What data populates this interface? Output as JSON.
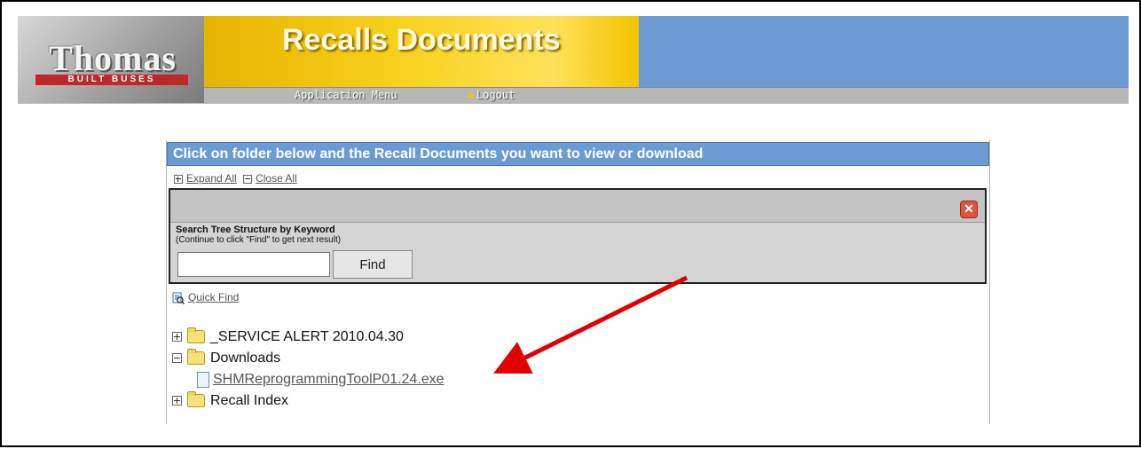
{
  "header": {
    "logo_text": "Thomas",
    "logo_subtext": "BUILT BUSES",
    "title": "Recalls Documents",
    "menu": {
      "application_menu": "Application Menu",
      "logout": "Logout"
    }
  },
  "panel": {
    "title": "Click on folder below and the Recall Documents you want to view or download",
    "expand_all": "Expand All",
    "close_all": "Close All",
    "search": {
      "label": "Search Tree Structure by Keyword",
      "hint": "(Continue to click \"Find\" to get next result)",
      "input_value": "",
      "find_label": "Find"
    },
    "quick_find": "Quick Find"
  },
  "tree": {
    "items": [
      {
        "label": "_SERVICE ALERT 2010.04.30",
        "expanded": false
      },
      {
        "label": "Downloads",
        "expanded": true
      },
      {
        "label": "SHMReprogrammingToolP01.24.exe",
        "type": "file"
      },
      {
        "label": "Recall Index",
        "expanded": false
      }
    ]
  },
  "colors": {
    "header_blue": "#6b9bd2",
    "title_yellow": "#f7d11e",
    "arrow_red": "#e00000"
  }
}
